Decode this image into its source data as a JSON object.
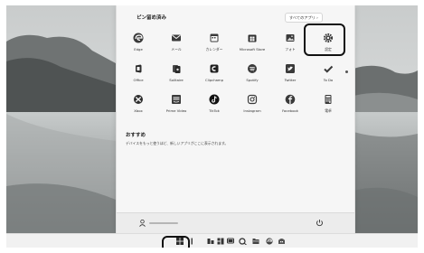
{
  "start_menu": {
    "pinned_title": "ピン留め済み",
    "all_apps_label": "すべてのアプリ  ›",
    "pinned_apps": [
      {
        "label": "Edge",
        "icon": "edge-icon"
      },
      {
        "label": "メール",
        "icon": "mail-icon"
      },
      {
        "label": "カレンダー",
        "icon": "calendar-icon"
      },
      {
        "label": "Microsoft Store",
        "icon": "store-icon"
      },
      {
        "label": "フォト",
        "icon": "photos-icon"
      },
      {
        "label": "設定",
        "icon": "settings-gear-icon"
      },
      {
        "label": "Office",
        "icon": "office-icon"
      },
      {
        "label": "Solitaire",
        "icon": "solitaire-icon"
      },
      {
        "label": "Clipchamp",
        "icon": "clipchamp-icon"
      },
      {
        "label": "Spotify",
        "icon": "spotify-icon"
      },
      {
        "label": "Twitter",
        "icon": "twitter-icon"
      },
      {
        "label": "To Do",
        "icon": "todo-check-icon"
      },
      {
        "label": "Xbox",
        "icon": "xbox-icon"
      },
      {
        "label": "Prime Video",
        "icon": "prime-video-icon"
      },
      {
        "label": "TikTok",
        "icon": "tiktok-icon"
      },
      {
        "label": "Instagram",
        "icon": "instagram-icon"
      },
      {
        "label": "Facebook",
        "icon": "facebook-icon"
      },
      {
        "label": "電卓",
        "icon": "calculator-icon"
      }
    ],
    "recommended_title": "おすすめ",
    "recommended_text": "デバイスをもっと使うほど、新しいアプリがここに表示されます。",
    "user": {
      "icon": "user-icon"
    },
    "power": {
      "icon": "power-icon"
    }
  },
  "taskbar": {
    "items": [
      {
        "name": "start-button",
        "icon": "windows-logo-icon"
      },
      {
        "name": "search-button",
        "icon": "search-icon"
      },
      {
        "name": "task-view-button",
        "icon": "task-view-icon"
      },
      {
        "name": "widgets-button",
        "icon": "widgets-icon"
      },
      {
        "name": "chat-button",
        "icon": "chat-icon"
      },
      {
        "name": "file-explorer-button",
        "icon": "folder-icon"
      },
      {
        "name": "edge-button",
        "icon": "edge-icon"
      },
      {
        "name": "store-button",
        "icon": "store-icon"
      }
    ]
  }
}
